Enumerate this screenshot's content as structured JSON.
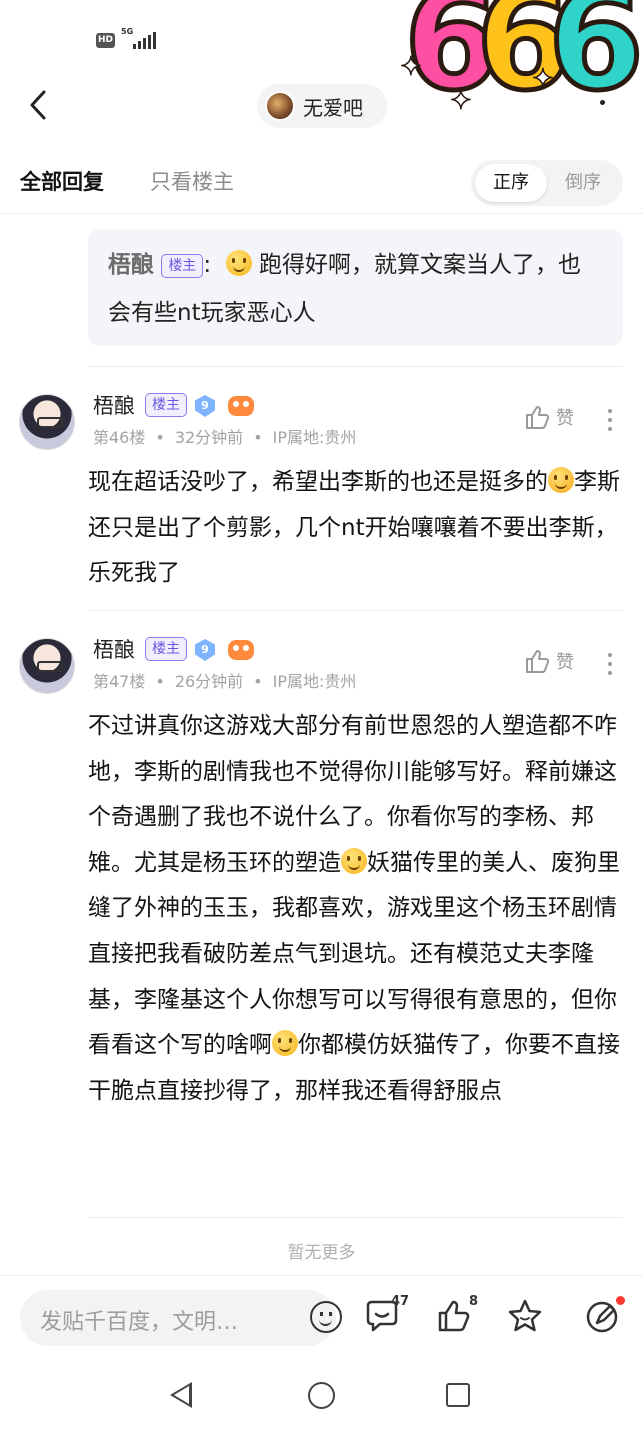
{
  "status_bar": {
    "hd_badge": "HD",
    "network": "5G"
  },
  "sticker": {
    "text": "666"
  },
  "header": {
    "back_icon": "chevron-left-icon",
    "forum_name": "无爱吧"
  },
  "tabs": {
    "all_replies": "全部回复",
    "op_only": "只看楼主"
  },
  "order": {
    "forward": "正序",
    "reverse": "倒序"
  },
  "quote": {
    "author": "梧酿",
    "badge": "楼主",
    "colon": ":",
    "text": "跑得好啊，就算文案当人了，也会有些nt玩家恶心人"
  },
  "replies": [
    {
      "author": "梧酿",
      "badge": "楼主",
      "level": "9",
      "floor": "第46楼",
      "time": "32分钟前",
      "ip": "IP属地:贵州",
      "like_label": "赞",
      "text_a": "现在超话没吵了，希望出李斯的也还是挺多的",
      "text_b": "李斯还只是出了个剪影，几个nt开始嚷嚷着不要出李斯，乐死我了"
    },
    {
      "author": "梧酿",
      "badge": "楼主",
      "level": "9",
      "floor": "第47楼",
      "time": "26分钟前",
      "ip": "IP属地:贵州",
      "like_label": "赞",
      "text_a": "不过讲真你这游戏大部分有前世恩怨的人塑造都不咋地，李斯的剧情我也不觉得你川能够写好。释前嫌这个奇遇删了我也不说什么了。你看你写的李杨、邦雉。尤其是杨玉环的塑造",
      "text_b": "妖猫传里的美人、废狗里缝了外神的玉玉，我都喜欢，游戏里这个杨玉环剧情直接把我看破防差点气到退坑。还有模范丈夫李隆基，李隆基这个人你想写可以写得很有意思的，但你看看这个写的啥啊",
      "text_c": "你都模仿妖猫传了，你要不直接干脆点直接抄得了，那样我还看得舒服点"
    }
  ],
  "footer_note": "暂无更多",
  "bottom_bar": {
    "input_placeholder": "发贴千百度，文明…",
    "comment_count": "47",
    "like_count": "8"
  },
  "colors": {
    "op_badge": "#8a7cf0",
    "level_badge": "#7db3ff",
    "red_dot": "#ff3b30"
  }
}
